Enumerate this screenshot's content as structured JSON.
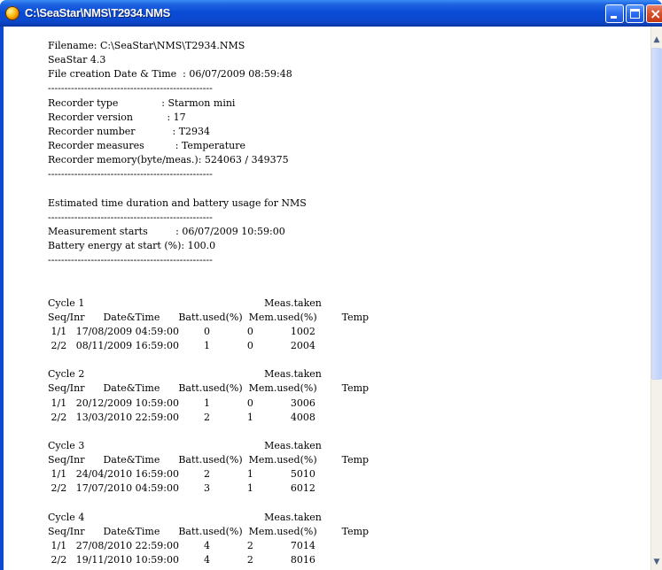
{
  "window": {
    "title": "C:\\SeaStar\\NMS\\T2934.NMS",
    "icon": "seastar-app-icon"
  },
  "lines": [
    "Filename: C:\\SeaStar\\NMS\\T2934.NMS",
    "SeaStar 4.3",
    "File creation Date & Time  : 06/07/2009 08:59:48",
    "--------------------------------------------------",
    "Recorder type              : Starmon mini",
    "Recorder version           : 17",
    "Recorder number            : T2934",
    "Recorder measures          : Temperature",
    "Recorder memory(byte/meas.): 524063 / 349375",
    "--------------------------------------------------",
    "",
    "Estimated time duration and battery usage for NMS",
    "--------------------------------------------------",
    "Measurement starts         : 06/07/2009 10:59:00",
    "Battery energy at start (%): 100.0",
    "--------------------------------------------------",
    "",
    "",
    "Cycle 1                                                          Meas.taken",
    "Seq/Inr      Date&Time      Batt.used(%)  Mem.used(%)        Temp",
    " 1/1   17/08/2009 04:59:00        0            0            1002",
    " 2/2   08/11/2009 16:59:00        1            0            2004",
    "",
    "Cycle 2                                                          Meas.taken",
    "Seq/Inr      Date&Time      Batt.used(%)  Mem.used(%)        Temp",
    " 1/1   20/12/2009 10:59:00        1            0            3006",
    " 2/2   13/03/2010 22:59:00        2            1            4008",
    "",
    "Cycle 3                                                          Meas.taken",
    "Seq/Inr      Date&Time      Batt.used(%)  Mem.used(%)        Temp",
    " 1/1   24/04/2010 16:59:00        2            1            5010",
    " 2/2   17/07/2010 04:59:00        3            1            6012",
    "",
    "Cycle 4                                                          Meas.taken",
    "Seq/Inr      Date&Time      Batt.used(%)  Mem.used(%)        Temp",
    " 1/1   27/08/2010 22:59:00        4            2            7014",
    " 2/2   19/11/2010 10:59:00        4            2            8016"
  ],
  "controls": {
    "minimize": "minimize",
    "maximize": "maximize",
    "close": "×"
  }
}
